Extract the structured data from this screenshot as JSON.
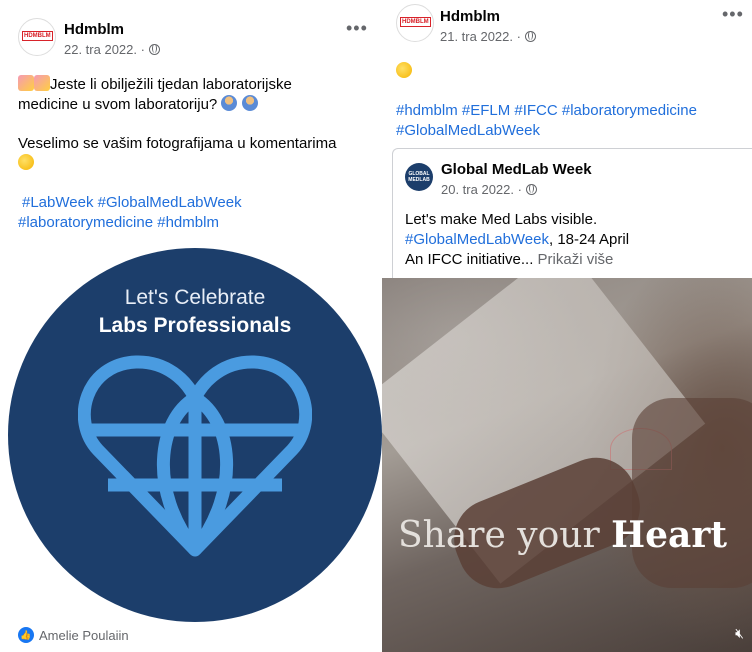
{
  "left_post": {
    "author": "Hdmblm",
    "avatar_logo": "HDMBLM",
    "date": "22. tra 2022. · ",
    "menu": "•••",
    "line1": "Jeste li obilježili tjedan laboratorijske",
    "line2": "medicine u svom laboratoriju?",
    "line3": "Veselimo se vašim fotografijama u komentarima",
    "hashtags1": "#LabWeek #GlobalMedLabWeek",
    "hashtags2": "#laboratorymedicine #hdmblm",
    "image_line1": "Let's Celebrate",
    "image_line2": "Labs Professionals",
    "liker": "Amelie Poulaiin"
  },
  "right_post": {
    "author": "Hdmblm",
    "date": "21. tra 2022. · ",
    "menu": "•••",
    "hashtags1": "#hdmblm #EFLM #IFCC #laboratorymedicine",
    "hashtags2": "#GlobalMedLabWeek",
    "shared": {
      "author": "Global MedLab Week",
      "avatar_text": "GLOBAL MEDLAB",
      "date": "20. tra 2022. · ",
      "line1": "Let's make Med Labs visible.",
      "line2_tag": "#GlobalMedLabWeek",
      "line2_rest": ", 18-24 April",
      "line3": "An IFCC initiative...",
      "see_more": "Prikaži više"
    },
    "video_text_light": "Share your ",
    "video_text_bold": "Heart",
    "mute_icon": "speaker-muted-icon"
  },
  "colors": {
    "accent": "#216fdb",
    "circle": "#1c3e6b",
    "heart": "#4a9be0"
  }
}
